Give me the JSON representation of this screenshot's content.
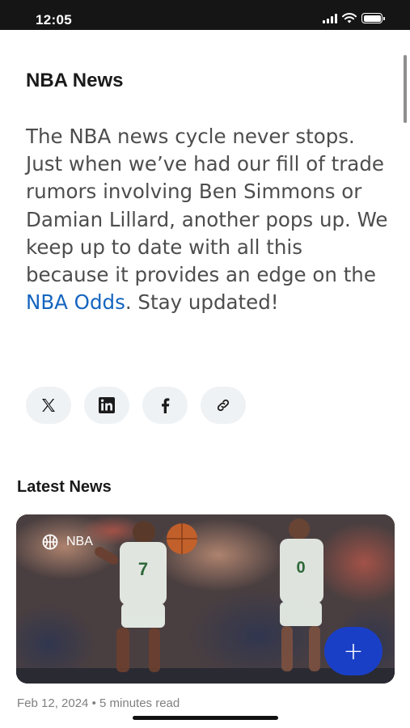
{
  "status_bar": {
    "time": "12:05",
    "icons": [
      "cellular-signal-icon",
      "wifi-icon",
      "battery-icon"
    ]
  },
  "article": {
    "title": "NBA News",
    "body_before_link": "The NBA news cycle never stops. Just when we’ve had our fill of trade rumors involving Ben Simmons or Damian Lillard, another pops up. We keep up to date with all this because it provides an edge on the ",
    "link_text": "NBA Odds",
    "body_after_link": ". Stay updated!",
    "link_color": "#1565c0"
  },
  "share": {
    "buttons": [
      {
        "icon": "x-twitter-icon"
      },
      {
        "icon": "linkedin-icon"
      },
      {
        "icon": "facebook-icon"
      },
      {
        "icon": "link-icon"
      }
    ]
  },
  "latest_news": {
    "heading": "Latest News",
    "cards": [
      {
        "badge": "NBA",
        "badge_icon": "basketball-icon",
        "date": "Feb 12, 2024",
        "separator": "•",
        "read_time": "5 minutes read",
        "action_label": "+"
      }
    ]
  },
  "colors": {
    "fab": "#1a3fc7",
    "status_bar": "#151515"
  }
}
